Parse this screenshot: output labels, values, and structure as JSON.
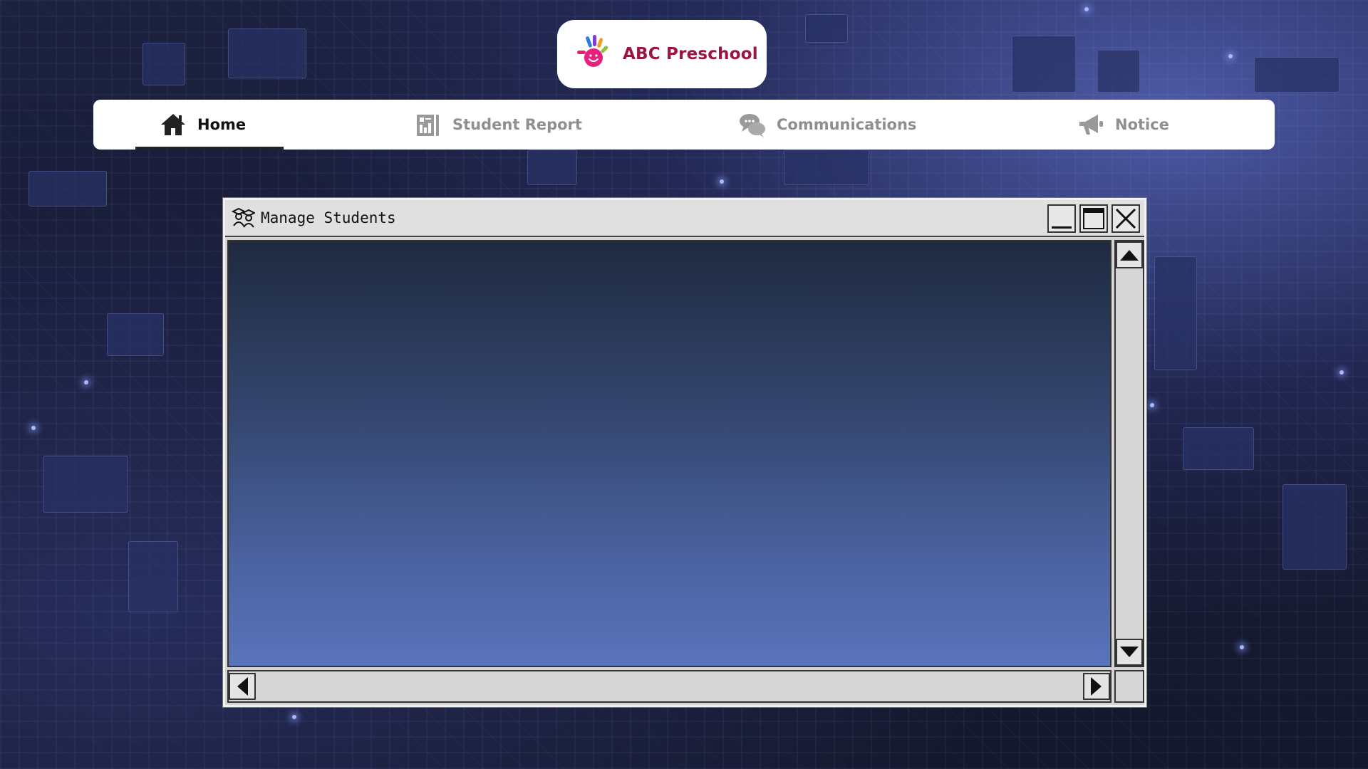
{
  "app": {
    "logo_text": "ABC Preschool",
    "logo_icon": "hand-smiley-icon"
  },
  "nav": {
    "items": [
      {
        "label": "Home",
        "icon": "home-icon",
        "active": true
      },
      {
        "label": "Student Report",
        "icon": "report-icon",
        "active": false
      },
      {
        "label": "Communications",
        "icon": "chat-icon",
        "active": false
      },
      {
        "label": "Notice",
        "icon": "megaphone-icon",
        "active": false
      }
    ]
  },
  "window": {
    "title": "Manage Students",
    "title_icon": "students-icon",
    "buttons": [
      "minimize",
      "maximize",
      "close"
    ]
  },
  "colors": {
    "brand_text": "#9a1540",
    "nav_active": "#111111",
    "nav_inactive": "#8f8f8f",
    "window_chrome": "#d4d4d4"
  }
}
